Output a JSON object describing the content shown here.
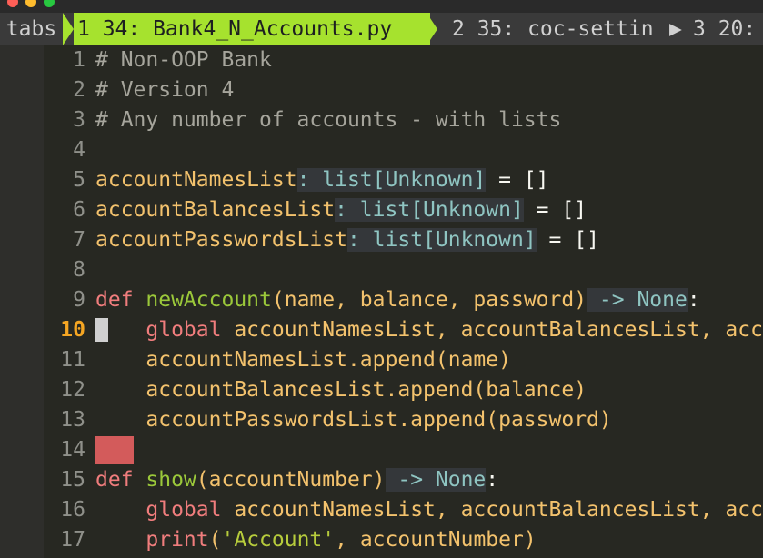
{
  "tabline": {
    "label": "tabs",
    "tab1": "1 34: Bank4_N_Accounts.py",
    "tab2": "2 35: coc-settin",
    "tab3": "3 20:"
  },
  "editor": {
    "current_line": 10,
    "lines": [
      {
        "num": "1",
        "tokens": [
          {
            "t": "# Non-OOP Bank",
            "c": "cm"
          }
        ]
      },
      {
        "num": "2",
        "tokens": [
          {
            "t": "# Version 4",
            "c": "cm"
          }
        ]
      },
      {
        "num": "3",
        "tokens": [
          {
            "t": "# Any number of accounts - with lists",
            "c": "cm"
          }
        ]
      },
      {
        "num": "4",
        "tokens": []
      },
      {
        "num": "5",
        "tokens": [
          {
            "t": "accountNamesList",
            "c": ""
          },
          {
            "t": ": list[Unknown]",
            "c": "ty hint"
          },
          {
            "t": " = ",
            "c": "white"
          },
          {
            "t": "[]",
            "c": "white"
          }
        ]
      },
      {
        "num": "6",
        "tokens": [
          {
            "t": "accountBalancesList",
            "c": ""
          },
          {
            "t": ": list[Unknown]",
            "c": "ty hint"
          },
          {
            "t": " = ",
            "c": "white"
          },
          {
            "t": "[]",
            "c": "white"
          }
        ]
      },
      {
        "num": "7",
        "tokens": [
          {
            "t": "accountPasswordsList",
            "c": ""
          },
          {
            "t": ": list[Unknown]",
            "c": "ty hint"
          },
          {
            "t": " = ",
            "c": "white"
          },
          {
            "t": "[]",
            "c": "white"
          }
        ]
      },
      {
        "num": "8",
        "tokens": []
      },
      {
        "num": "9",
        "tokens": [
          {
            "t": "def ",
            "c": "kw"
          },
          {
            "t": "newAccount",
            "c": "fn"
          },
          {
            "t": "(name, balance, password)",
            "c": ""
          },
          {
            "t": " -> None",
            "c": "ty hint"
          },
          {
            "t": ":",
            "c": "white"
          }
        ]
      },
      {
        "num": "10",
        "tokens": [
          {
            "t": "    ",
            "c": ""
          },
          {
            "t": "global",
            "c": "kw"
          },
          {
            "t": " accountNamesList, accountBalancesList, acc",
            "c": ""
          }
        ]
      },
      {
        "num": "11",
        "tokens": [
          {
            "t": "    accountNamesList.append(name)",
            "c": ""
          }
        ]
      },
      {
        "num": "12",
        "tokens": [
          {
            "t": "    accountBalancesList.append(balance)",
            "c": ""
          }
        ]
      },
      {
        "num": "13",
        "tokens": [
          {
            "t": "    accountPasswordsList.append(password)",
            "c": ""
          }
        ]
      },
      {
        "num": "14",
        "tokens": []
      },
      {
        "num": "15",
        "tokens": [
          {
            "t": "def ",
            "c": "kw"
          },
          {
            "t": "show",
            "c": "fn"
          },
          {
            "t": "(accountNumber)",
            "c": ""
          },
          {
            "t": " -> None",
            "c": "ty hint"
          },
          {
            "t": ":",
            "c": "white"
          }
        ]
      },
      {
        "num": "16",
        "tokens": [
          {
            "t": "    ",
            "c": ""
          },
          {
            "t": "global",
            "c": "kw"
          },
          {
            "t": " accountNamesList, accountBalancesList, acc",
            "c": ""
          }
        ]
      },
      {
        "num": "17",
        "tokens": [
          {
            "t": "    ",
            "c": ""
          },
          {
            "t": "print",
            "c": "kw"
          },
          {
            "t": "(",
            "c": ""
          },
          {
            "t": "'Account'",
            "c": "st"
          },
          {
            "t": ", accountNumber)",
            "c": ""
          }
        ]
      }
    ]
  },
  "colors": {
    "tab_active_bg": "#a6e22e",
    "tab_label_bg": "#3a3a3a",
    "error_sign": "#d35b5b",
    "current_line_number": "#f5a623"
  }
}
